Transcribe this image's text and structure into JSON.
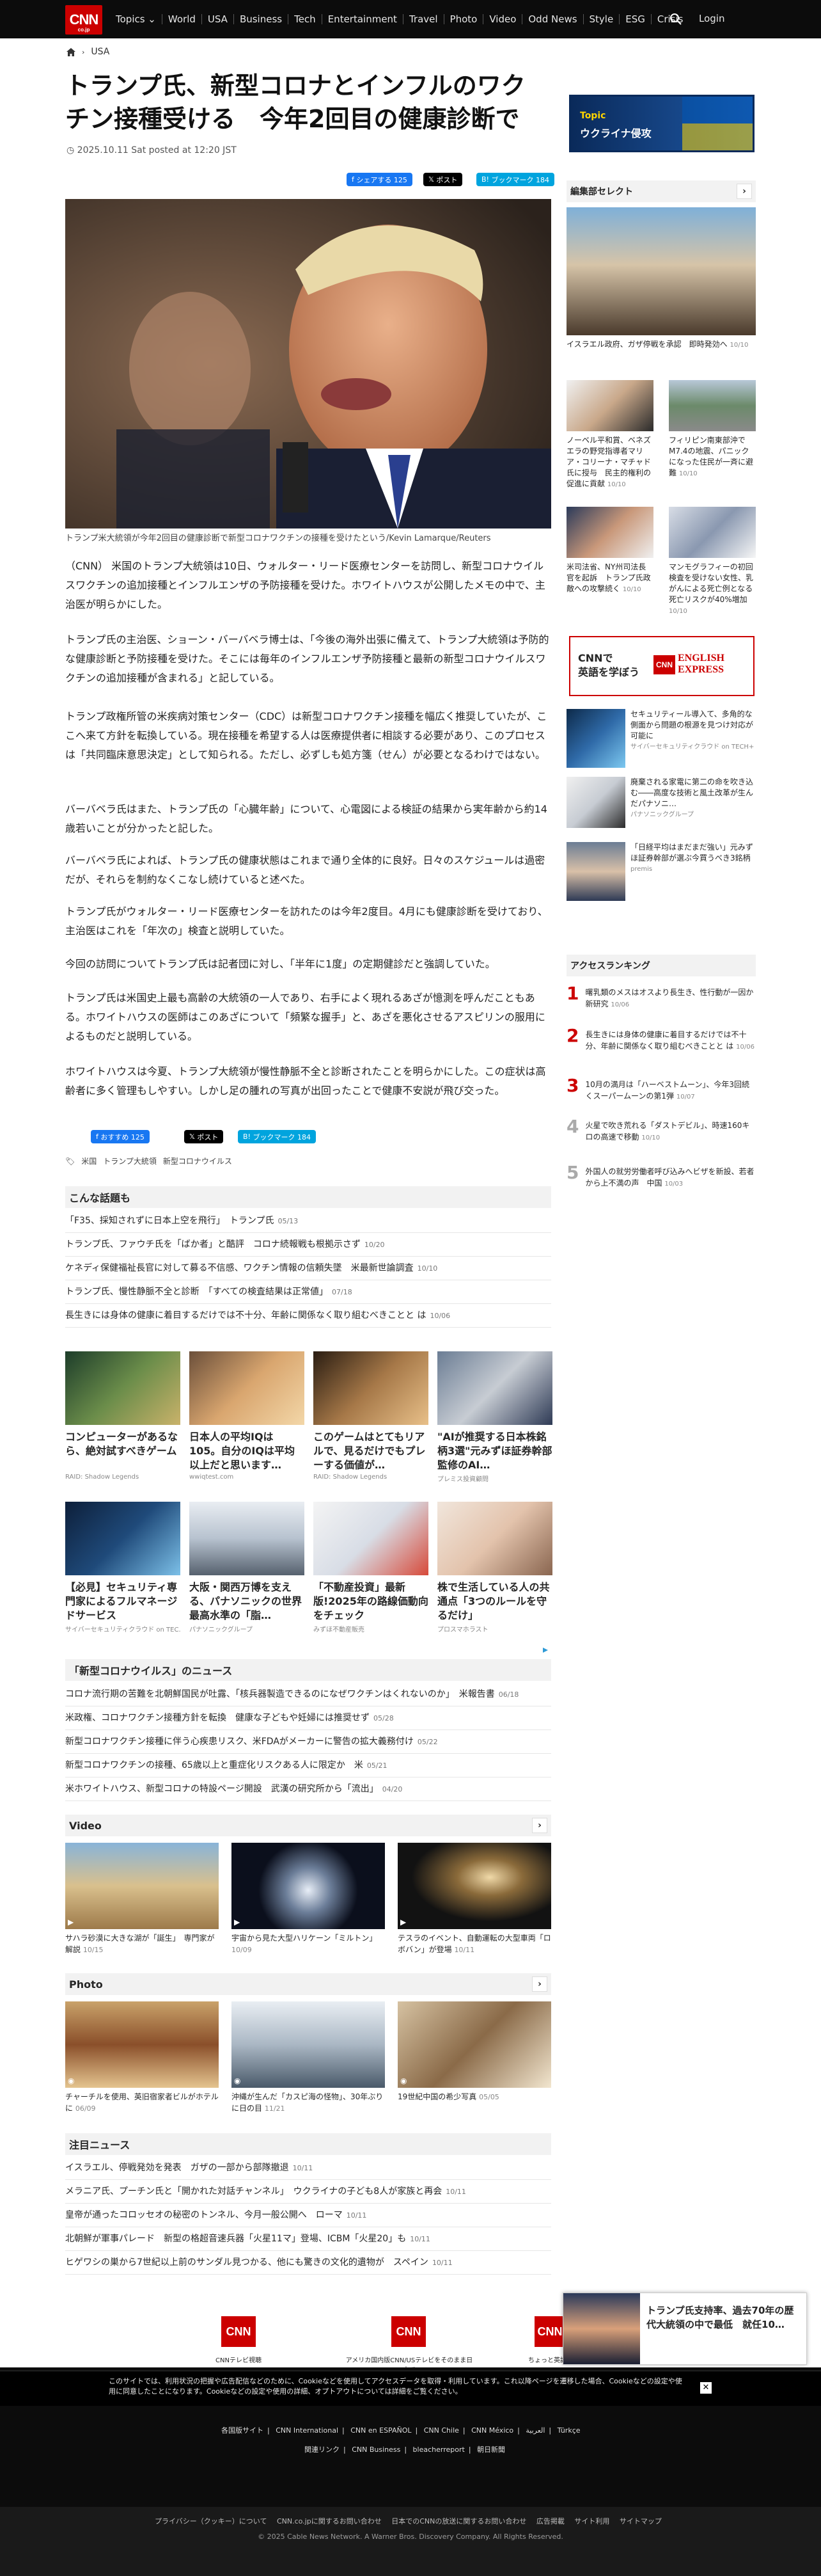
{
  "header": {
    "logo_text": "CNN",
    "logo_sub": "co.jp",
    "nav": [
      "Topics ⌄",
      "World",
      "USA",
      "Business",
      "Tech",
      "Entertainment",
      "Travel",
      "Photo",
      "Video",
      "Odd News",
      "Style",
      "ESG",
      "Crisis"
    ],
    "login": "Login"
  },
  "breadcrumb": {
    "section": "USA"
  },
  "article": {
    "title": "トランプ氏、新型コロナとインフルのワクチン接種受ける　今年2回目の健康診断で",
    "date": "2025.10.11 Sat posted at 12:20 JST",
    "share_fb": "シェアする 125",
    "share_x": "ポスト",
    "share_hb": "ブックマーク 184",
    "caption": "トランプ米大統領が今年2回目の健康診断で新型コロナワクチンの接種を受けたという/Kevin Lamarque/Reuters",
    "paragraphs": [
      "（CNN） 米国のトランプ大統領は10日、ウォルター・リード医療センターを訪問し、新型コロナウイルスワクチンの追加接種とインフルエンザの予防接種を受けた。ホワイトハウスが公開したメモの中で、主治医が明らかにした。",
      "トランプ氏の主治医、ショーン・バーバベラ博士は、「今後の海外出張に備えて、トランプ大統領は予防的な健康診断と予防接種を受けた。そこには毎年のインフルエンザ予防接種と最新の新型コロナウイルスワクチンの追加接種が含まれる」と記している。",
      "トランプ政権所管の米疾病対策センター（CDC）は新型コロナワクチン接種を幅広く推奨していたが、ここへ来て方針を転換している。現在接種を希望する人は医療提供者に相談する必要があり、このプロセスは「共同臨床意思決定」として知られる。ただし、必ずしも処方箋（せん）が必要となるわけではない。",
      "バーバベラ氏はまた、トランプ氏の「心臓年齢」について、心電図による検証の結果から実年齢から約14歳若いことが分かったと記した。",
      "バーバベラ氏によれば、トランプ氏の健康状態はこれまで通り全体的に良好。日々のスケジュールは過密だが、それらを制約なくこなし続けていると述べた。",
      "トランプ氏がウォルター・リード医療センターを訪れたのは今年2度目。4月にも健康診断を受けており、主治医はこれを「年次の」検査と説明していた。",
      "今回の訪問についてトランプ氏は記者団に対し、「半年に1度」の定期健診だと強調していた。",
      "トランプ氏は米国史上最も高齢の大統領の一人であり、右手によく現れるあざが憶測を呼んだこともある。ホワイトハウスの医師はこのあざについて「頻繁な握手」と、あざを悪化させるアスピリンの服用によるものだと説明している。",
      "ホワイトハウスは今夏、トランプ大統領が慢性静脈不全と診断されたことを明らかにした。この症状は高齢者に多く管理もしやすい。しかし足の腫れの写真が出回ったことで健康不安説が飛び交った。"
    ],
    "bottom_share_fb": "おすすめ 125",
    "bottom_share_x": "ポスト",
    "bottom_share_hb": "ブックマーク 184",
    "tags": [
      "米国",
      "トランプ大統領",
      "新型コロナウイルス"
    ]
  },
  "related": {
    "heading": "こんな話題も",
    "items": [
      {
        "text": "「F35、採知されずに日本上空を飛行」　トランプ氏",
        "date": "05/13"
      },
      {
        "text": "トランプ氏、ファウチ氏を「ばか者」と酷評　コロナ続報戦も根拠示さず",
        "date": "10/20"
      },
      {
        "text": "ケネディ保健福祉長官に対して募る不信感、ワクチン情報の信頼失墜　米最新世論調査",
        "date": "10/10"
      },
      {
        "text": "トランプ氏、慢性静脈不全と診断　「すべての検査結果は正常値」",
        "date": "07/18"
      },
      {
        "text": "長生きには身体の健康に着目するだけでは不十分、年齢に関係なく取り組むべきことと は",
        "date": "10/06"
      }
    ]
  },
  "ads": [
    {
      "title": "コンピューターがあるなら、絶対試すべきゲーム",
      "src": "RAID: Shadow Legends"
    },
    {
      "title": "日本人の平均IQは105。自分のIQは平均以上だと思います…",
      "src": "wwiqtest.com"
    },
    {
      "title": "このゲームはとてもリアルで、見るだけでもプレーする価値が…",
      "src": "RAID: Shadow Legends"
    },
    {
      "title": "\"AIが推奨する日本株銘柄3選\"元みずほ証券幹部監修のAI…",
      "src": "プレミス投資顧問"
    },
    {
      "title": "【必見】セキュリティ専門家によるフルマネージドサービス",
      "src": "サイバーセキュリティクラウド on TEC…"
    },
    {
      "title": "大阪・関西万博を支える、パナソニックの世界最高水準の「脂…",
      "src": "パナソニックグループ"
    },
    {
      "title": "「不動産投資」最新版!2025年の路線価動向をチェック",
      "src": "みずほ不動産販売"
    },
    {
      "title": "株で生活している人の共通点「3つのルールを守るだけ」",
      "src": "プロスマホラスト"
    }
  ],
  "corona_news": {
    "heading": "「新型コロナウイルス」のニュース",
    "items": [
      {
        "text": "コロナ流行期の苦難を北朝鮮国民が吐露、「核兵器製造できるのになぜワクチンはくれないのか」　米報告書",
        "date": "06/18"
      },
      {
        "text": "米政権、コロナワクチン接種方針を転換　健康な子どもや妊婦には推奨せず",
        "date": "05/28"
      },
      {
        "text": "新型コロナワクチン接種に伴う心疾患リスク、米FDAがメーカーに警告の拡大義務付け",
        "date": "05/22"
      },
      {
        "text": "新型コロナワクチンの接種、65歳以上と重症化リスクある人に限定か　米",
        "date": "05/21"
      },
      {
        "text": "米ホワイトハウス、新型コロナの特設ページ開設　武漢の研究所から「流出」",
        "date": "04/20"
      }
    ]
  },
  "video": {
    "heading": "Video",
    "items": [
      {
        "text": "サハラ砂漠に大きな湖が「誕生」　専門家が解説",
        "date": "10/15"
      },
      {
        "text": "宇宙から見た大型ハリケーン「ミルトン」",
        "date": "10/09"
      },
      {
        "text": "テスラのイベント、自動運転の大型車両「ロボバン」が登場",
        "date": "10/11"
      }
    ]
  },
  "photo": {
    "heading": "Photo",
    "items": [
      {
        "text": "チャーチルを使用、英旧宿家者ビルがホテルに",
        "date": "06/09"
      },
      {
        "text": "沖縄が生んだ「カスピ海の怪物」、30年ぶりに日の目",
        "date": "11/21"
      },
      {
        "text": "19世紀中国の希少写真",
        "date": "05/05"
      }
    ]
  },
  "attention": {
    "heading": "注目ニュース",
    "items": [
      {
        "text": "イスラエル、停戦発効を発表　ガザの一部から部隊撤退",
        "date": "10/11"
      },
      {
        "text": "メラニア氏、プーチン氏と「開かれた対話チャンネル」　ウクライナの子ども8人が家族と再会",
        "date": "10/11"
      },
      {
        "text": "皇帝が通ったコロッセオの秘密のトンネル、今月一般公開へ　ローマ",
        "date": "10/11"
      },
      {
        "text": "北朝鮮が軍事パレード　新型の格超音速兵器「火星11マ」登場、ICBM「火星20」も",
        "date": "10/11"
      },
      {
        "text": "ヒゲワシの巣から7世紀以上前のサンダル見つかる、他にも驚きの文化的遺物が　スペイン",
        "date": "10/11"
      }
    ]
  },
  "sidebar": {
    "banner_topic": "Topic",
    "banner_title": "ウクライナ侵攻",
    "select_heading": "編集部セレクト",
    "select_main": {
      "text": "イスラエル政府、ガザ停戦を承認　即時発効へ",
      "date": "10/10"
    },
    "select_items": [
      {
        "text": "ノーベル平和賞、ベネズエラの野党指導者マリア・コリーナ・マチャド氏に授与　民主的権利の促進に貢献",
        "date": "10/10"
      },
      {
        "text": "フィリピン南東部沖でM7.4の地震、パニックになった住民が一斉に避難",
        "date": "10/10"
      },
      {
        "text": "米司法省、NY州司法長官を起訴　トランプ氏政敵への攻撃続く",
        "date": "10/10"
      },
      {
        "text": "マンモグラフィーの初回検査を受けない女性、乳がんによる死亡例となる死亡リスクが40%増加",
        "date": "10/10"
      }
    ],
    "english_text1": "CNNで",
    "english_text2": "英語を学ぼう",
    "english_logo": "ENGLISH EXPRESS",
    "pr_items": [
      {
        "text": "セキュリティール導入て、多角的な側面から問題の根源を見つけ対応が可能に",
        "src": "サイバーセキュリティクラウド on TECH+"
      },
      {
        "text": "廃棄される家電に第二の命を吹き込む――高度な技術と風土改革が生んだパナソニ…",
        "src": "パナソニックグループ"
      },
      {
        "text": "「日経平均はまだまだ強い」元みずほ証券幹部が選ぶ今買うべき3銘柄",
        "src": "premis"
      }
    ],
    "ranking_heading": "アクセスランキング",
    "ranking": [
      {
        "num": "1",
        "text": "曙乳類のメスはオスより長生き、性行動が一因か　新研究",
        "date": "10/06"
      },
      {
        "num": "2",
        "text": "長生きには身体の健康に着目するだけでは不十分、年齢に関係なく取り組むべきことと は",
        "date": "10/06"
      },
      {
        "num": "3",
        "text": "10月の満月は「ハーベストムーン」、今年3回続くスーパームーンの第1弾",
        "date": "10/07"
      },
      {
        "num": "4",
        "text": "火星で吹き荒れる「ダストデビル」、時速160キロの高速で移動",
        "date": "10/10"
      },
      {
        "num": "5",
        "text": "外国人の就労労働者呼び込みへビザを新設、若者から上不満の声　中国",
        "date": "10/03"
      }
    ]
  },
  "footer": {
    "logos": [
      {
        "label": "CNNテレビ視聴"
      },
      {
        "label": "アメリカ国内版CNN/USテレビをそのまま日本で"
      },
      {
        "label": "ちょっと英語"
      }
    ],
    "popup_title": "トランプ氏支持率、過去70年の歴代大統領の中で最低　就任10…",
    "cookie_text": "このサイトでは、利用状況の把握や広告配信などのために、Cookieなどを使用してアクセスデータを取得・利用しています。これ以降ページを遷移した場合、Cookieなどの設定や使用に同意したことになります。Cookieなどの設定や使用の詳細、オプトアウトについては詳細をご覧ください。",
    "links1": [
      "各国版サイト",
      "CNN International",
      "CNN en ESPAÑOL",
      "CNN Chile",
      "CNN México",
      "العربية",
      "Türkçe"
    ],
    "links2": [
      "関連リンク",
      "CNN Business",
      "bleacherreport",
      "朝日新聞"
    ],
    "links3": [
      "プライバシー（クッキー）について",
      "CNN.co.jpに関するお問い合わせ",
      "日本でのCNNの放送に関するお問い合わせ",
      "広告掲載",
      "サイト利用",
      "サイトマップ"
    ],
    "copyright": "© 2025 Cable News Network. A Warner Bros. Discovery Company. All Rights Reserved."
  }
}
